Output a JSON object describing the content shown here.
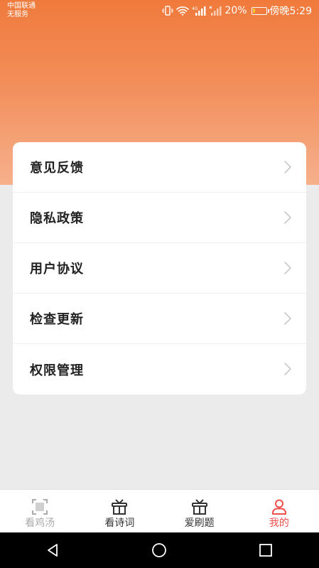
{
  "status_bar": {
    "carrier_line1": "中国联通",
    "carrier_line2": "无服务",
    "signal_badge": "4G",
    "battery_percent_text": "20%",
    "battery_level": 0.2,
    "battery_fill_color": "#f5c32c",
    "time": "傍晚5:29"
  },
  "header": {
    "gradient_top": "#f07a3c",
    "gradient_bottom": "#f6b08c"
  },
  "menu": {
    "items": [
      {
        "label": "意见反馈"
      },
      {
        "label": "隐私政策"
      },
      {
        "label": "用户协议"
      },
      {
        "label": "检查更新"
      },
      {
        "label": "权限管理"
      }
    ]
  },
  "tab_bar": {
    "active_color": "#f0504c",
    "inactive_color": "#aaaaaa",
    "normal_color": "#333333",
    "tabs": [
      {
        "label": "看鸡汤",
        "icon": "scan-frame-icon",
        "state": "disabled"
      },
      {
        "label": "看诗词",
        "icon": "gift-box-icon",
        "state": "normal"
      },
      {
        "label": "爱刷题",
        "icon": "gift-box-icon",
        "state": "normal"
      },
      {
        "label": "我的",
        "icon": "person-icon",
        "state": "active"
      }
    ]
  },
  "nav_bar": {
    "buttons": [
      "back",
      "home",
      "recents"
    ]
  }
}
